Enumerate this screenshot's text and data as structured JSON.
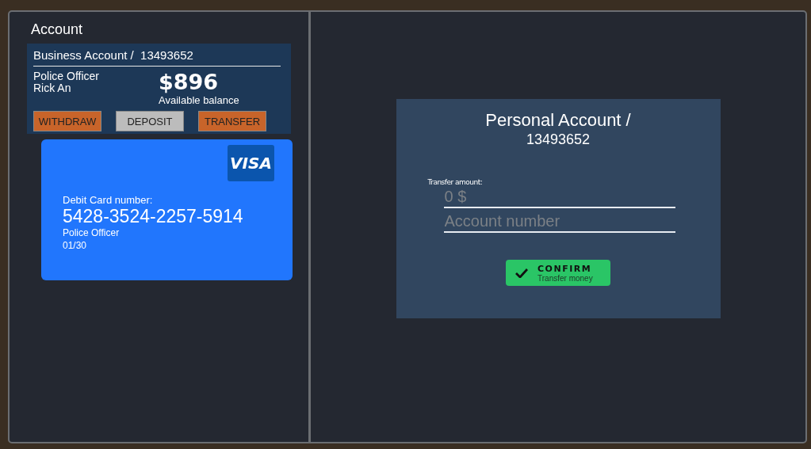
{
  "account": {
    "title": "Account",
    "business": {
      "title": "Business Account /",
      "number": "13493652",
      "role": "Police Officer",
      "name": "Rick An",
      "balance": "$896",
      "balance_label": "Available balance"
    },
    "buttons": [
      {
        "label": "WITHDRAW",
        "color": "#c8642a"
      },
      {
        "label": "DEPOSIT",
        "color": "#bcbcbc"
      },
      {
        "label": "TRANSFER",
        "color": "#c8642a"
      }
    ],
    "card": {
      "brand": "VISA",
      "number_label": "Debit Card number:",
      "number": "5428-3524-2257-5914",
      "holder": "Police Officer",
      "expiry": "01/30"
    }
  },
  "transfer": {
    "title": "Personal Account /",
    "number": "13493652",
    "amount_label": "Transfer amount:",
    "fields": [
      {
        "placeholder": "0 $"
      },
      {
        "placeholder": "Account number"
      }
    ],
    "confirm": {
      "label": "CONFIRM",
      "sublabel": "Transfer money"
    }
  }
}
